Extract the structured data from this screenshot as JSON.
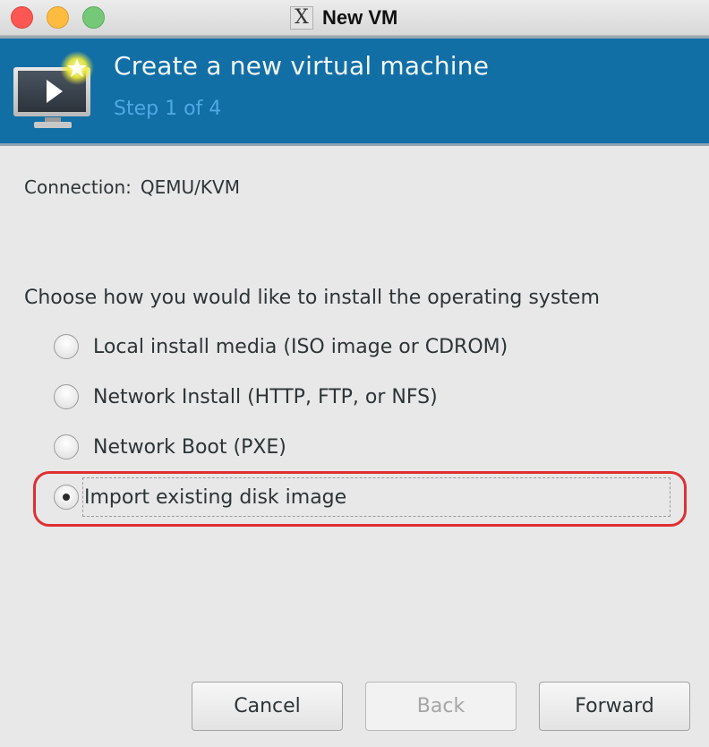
{
  "window": {
    "title": "New VM",
    "app_icon": "x11-icon",
    "controls": [
      "close",
      "minimize",
      "maximize"
    ]
  },
  "header": {
    "icon": "new-vm-monitor-icon",
    "title": "Create a new virtual machine",
    "subtitle": "Step 1 of 4",
    "background_color": "#126fa6"
  },
  "connection": {
    "label": "Connection:",
    "value": "QEMU/KVM"
  },
  "install": {
    "prompt": "Choose how you would like to install the operating system",
    "options": [
      {
        "label": "Local install media (ISO image or CDROM)",
        "selected": false
      },
      {
        "label": "Network Install (HTTP, FTP, or NFS)",
        "selected": false
      },
      {
        "label": "Network Boot (PXE)",
        "selected": false
      },
      {
        "label": "Import existing disk image",
        "selected": true
      }
    ],
    "highlight_color": "#e02f33"
  },
  "buttons": {
    "cancel": "Cancel",
    "back": "Back",
    "back_disabled": true,
    "forward": "Forward"
  }
}
